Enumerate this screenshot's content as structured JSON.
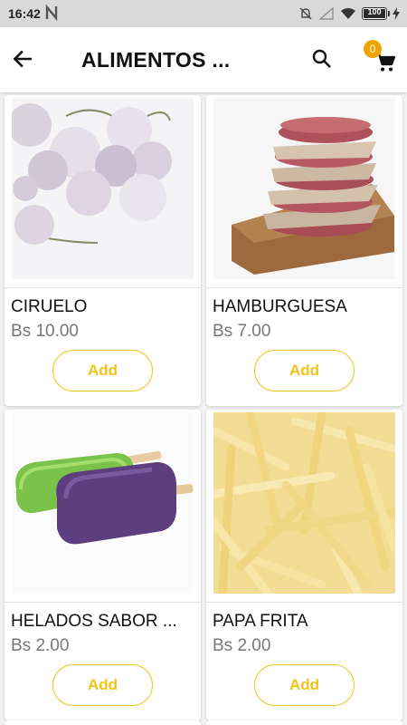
{
  "status_bar": {
    "time": "16:42",
    "battery": "100",
    "battery_level": 1.0
  },
  "app_bar": {
    "title": "ALIMENTOS ...",
    "back_icon": "arrow-left-icon",
    "search_icon": "search-icon",
    "cart_icon": "shopping-cart-icon",
    "cart_count": "0",
    "badge_color": "#f0a400"
  },
  "accent_color": "#f0c419",
  "products": [
    {
      "name": "CIRUELO",
      "price": "Bs 10.00",
      "add_label": "Add",
      "image": "frozen-plums"
    },
    {
      "name": "HAMBURGUESA",
      "price": "Bs 7.00",
      "add_label": "Add",
      "image": "burger-patties"
    },
    {
      "name": "HELADOS SABOR ...",
      "price": "Bs 2.00",
      "add_label": "Add",
      "image": "popsicles"
    },
    {
      "name": "PAPA FRITA",
      "price": "Bs 2.00",
      "add_label": "Add",
      "image": "french-fries"
    }
  ]
}
